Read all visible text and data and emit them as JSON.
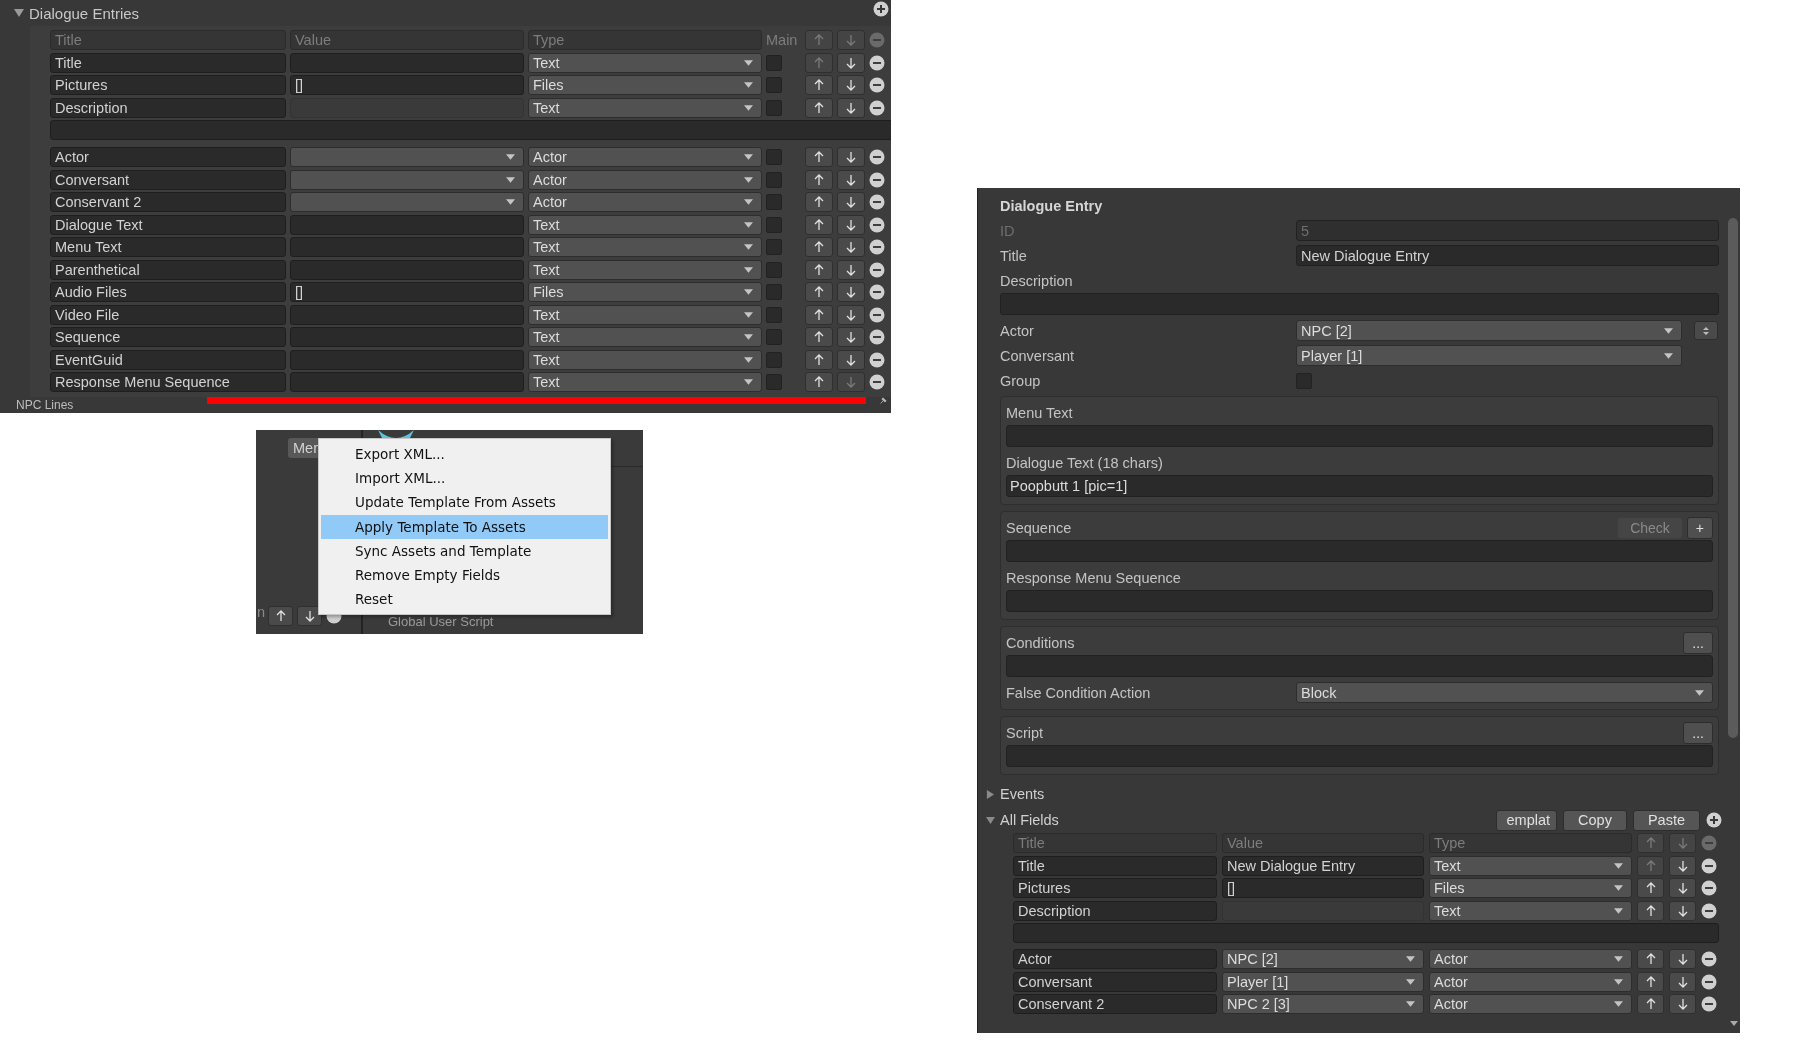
{
  "entries_panel": {
    "title": "Dialogue Entries",
    "expanded": true,
    "columns": [
      "Title",
      "Value",
      "Type",
      "Main"
    ],
    "rows": [
      {
        "title": "Title",
        "kind": "text",
        "type": "Text",
        "main": false,
        "up_disabled": true,
        "down_disabled": false
      },
      {
        "title": "Pictures",
        "kind": "text",
        "value": "[]",
        "type": "Files",
        "main": false,
        "up_disabled": false,
        "down_disabled": false
      },
      {
        "title": "Description",
        "kind": "readonly",
        "type": "Text",
        "main": false,
        "up_disabled": false,
        "down_disabled": false,
        "textarea": true
      },
      {
        "title": "Actor",
        "kind": "popup",
        "type": "Actor",
        "main": false,
        "up_disabled": false,
        "down_disabled": false
      },
      {
        "title": "Conversant",
        "kind": "popup",
        "type": "Actor",
        "main": false,
        "up_disabled": false,
        "down_disabled": false
      },
      {
        "title": "Conservant 2",
        "kind": "popup",
        "type": "Actor",
        "main": false,
        "up_disabled": false,
        "down_disabled": false
      },
      {
        "title": "Dialogue Text",
        "kind": "text",
        "type": "Text",
        "main": false,
        "up_disabled": false,
        "down_disabled": false
      },
      {
        "title": "Menu Text",
        "kind": "text",
        "type": "Text",
        "main": false,
        "up_disabled": false,
        "down_disabled": false
      },
      {
        "title": "Parenthetical",
        "kind": "text",
        "type": "Text",
        "main": false,
        "up_disabled": false,
        "down_disabled": false
      },
      {
        "title": "Audio Files",
        "kind": "text",
        "value": "[]",
        "type": "Files",
        "main": false,
        "up_disabled": false,
        "down_disabled": false
      },
      {
        "title": "Video File",
        "kind": "text",
        "type": "Text",
        "main": false,
        "up_disabled": false,
        "down_disabled": false
      },
      {
        "title": "Sequence",
        "kind": "text",
        "type": "Text",
        "main": false,
        "up_disabled": false,
        "down_disabled": false
      },
      {
        "title": "EventGuid",
        "kind": "text",
        "type": "Text",
        "main": false,
        "up_disabled": false,
        "down_disabled": false
      },
      {
        "title": "Response Menu Sequence",
        "kind": "text",
        "type": "Text",
        "main": false,
        "up_disabled": false,
        "down_disabled": true
      }
    ],
    "footer": "NPC Lines"
  },
  "menu_panel": {
    "button": "Mer",
    "side_text": "n",
    "script_label": "Global User Script",
    "items": [
      {
        "label": "Export XML...",
        "selected": false
      },
      {
        "label": "Import XML...",
        "selected": false
      },
      {
        "label": "Update Template From Assets",
        "selected": false
      },
      {
        "label": "Apply Template To Assets",
        "selected": true
      },
      {
        "label": "Sync Assets and Template",
        "selected": false
      },
      {
        "label": "Remove Empty Fields",
        "selected": false
      },
      {
        "label": "Reset",
        "selected": false
      }
    ]
  },
  "inspector": {
    "title": "Dialogue Entry",
    "fields": [
      {
        "kind": "text",
        "label": "ID",
        "value": "5",
        "disabled": true
      },
      {
        "kind": "text",
        "label": "Title",
        "value": "New Dialogue Entry",
        "disabled": false
      },
      {
        "kind": "area",
        "label": "Description"
      },
      {
        "kind": "popup",
        "label": "Actor",
        "value": "NPC [2]",
        "swap": true
      },
      {
        "kind": "popup",
        "label": "Conversant",
        "value": "Player [1]",
        "swap": false
      },
      {
        "kind": "checkbox",
        "label": "Group",
        "checked": false
      }
    ],
    "sections": [
      {
        "fields": [
          {
            "kind": "area",
            "label": "Menu Text"
          },
          {
            "kind": "area",
            "label": "Dialogue Text (18 chars)",
            "value": "Poopbutt 1 [pic=1]"
          }
        ]
      },
      {
        "fields": [
          {
            "kind": "area",
            "label": "Sequence",
            "buttons": [
              {
                "label": "Check",
                "disabled": true
              },
              {
                "label": "+",
                "disabled": false
              }
            ]
          },
          {
            "kind": "area",
            "label": "Response Menu Sequence"
          }
        ]
      },
      {
        "fields": [
          {
            "kind": "area",
            "label": "Conditions",
            "buttons": [
              {
                "label": "...",
                "disabled": false
              }
            ]
          },
          {
            "kind": "popup",
            "label": "False Condition Action",
            "value": "Block",
            "wide": true
          }
        ]
      },
      {
        "fields": [
          {
            "kind": "area",
            "label": "Script",
            "buttons": [
              {
                "label": "...",
                "disabled": false
              }
            ]
          }
        ]
      }
    ],
    "foldouts": [
      {
        "label": "Events",
        "expanded": false
      },
      {
        "label": "All Fields",
        "expanded": true,
        "buttons": [
          "emplat",
          "Copy",
          "Paste"
        ],
        "columns": [
          "Title",
          "Value",
          "Type"
        ],
        "rows": [
          {
            "title": "Title",
            "kind": "text",
            "value": "New Dialogue Entry",
            "type": "Text",
            "up_disabled": true,
            "down_disabled": false
          },
          {
            "title": "Pictures",
            "kind": "text",
            "value": "[]",
            "type": "Files",
            "up_disabled": false,
            "down_disabled": false
          },
          {
            "title": "Description",
            "kind": "readonly",
            "type": "Text",
            "up_disabled": false,
            "down_disabled": false,
            "textarea": true
          },
          {
            "title": "Actor",
            "kind": "popup",
            "value": "NPC [2]",
            "type": "Actor",
            "up_disabled": false,
            "down_disabled": false
          },
          {
            "title": "Conversant",
            "kind": "popup",
            "value": "Player [1]",
            "type": "Actor",
            "up_disabled": false,
            "down_disabled": false
          },
          {
            "title": "Conservant 2",
            "kind": "popup",
            "value": "NPC 2 [3]",
            "type": "Actor",
            "up_disabled": false,
            "down_disabled": false
          }
        ]
      }
    ]
  }
}
